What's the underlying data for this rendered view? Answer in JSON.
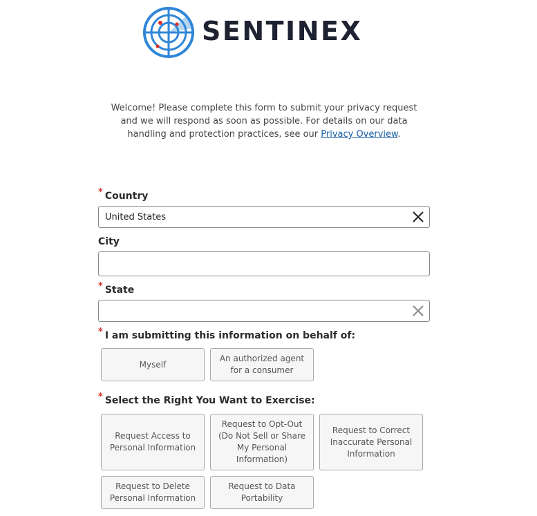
{
  "brand": {
    "name": "SENTINEX",
    "colors": {
      "ring": "#2f86d8",
      "dots": "#d9312b",
      "text": "#1f2230"
    }
  },
  "intro": {
    "text_before": "Welcome! Please complete this form to submit your privacy request and we will respond as soon as possible. For details on our data handling and protection practices, see our ",
    "link_text": "Privacy Overview",
    "text_after": "."
  },
  "form": {
    "required_mark": "*",
    "country": {
      "label": "Country",
      "value": "United States",
      "clear_icon": "close-icon"
    },
    "city": {
      "label": "City",
      "value": ""
    },
    "state": {
      "label": "State",
      "value": "",
      "clear_icon": "close-icon"
    },
    "behalf": {
      "label": "I am submitting this information on behalf of:",
      "options": [
        "Myself",
        "An authorized agent for a consumer"
      ]
    },
    "rights": {
      "label": "Select the Right You Want to Exercise:",
      "options": [
        "Request Access to Personal Information",
        "Request to Opt-Out (Do Not Sell or Share My Personal Information)",
        "Request to Correct Inaccurate Personal Information",
        "Request to Delete Personal Information",
        "Request to Data Portability"
      ]
    }
  }
}
